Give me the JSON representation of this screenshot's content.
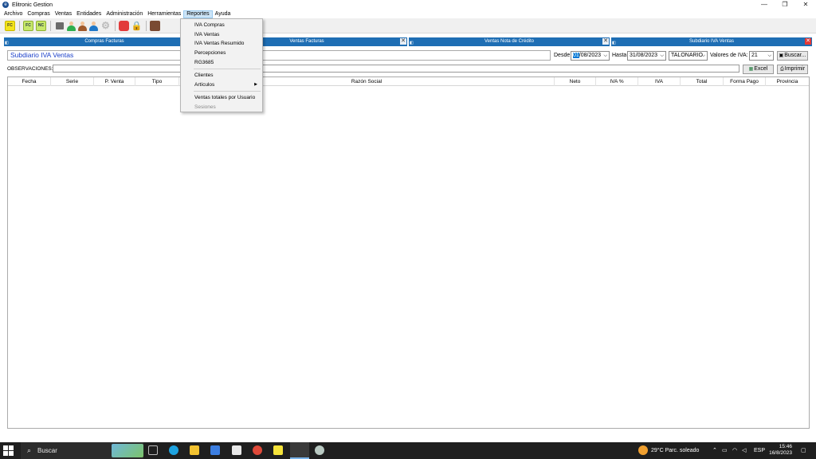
{
  "window": {
    "title": "Elitronic Gestion",
    "minimize": "—",
    "restore": "❐",
    "close": "✕"
  },
  "menu": {
    "items": [
      "Archivo",
      "Compras",
      "Ventas",
      "Entidades",
      "Administración",
      "Herramientas",
      "Reportes",
      "Ayuda"
    ],
    "active": "Reportes"
  },
  "toolbar": {
    "fc": "FC",
    "fc2": "FC",
    "nc": "NC"
  },
  "tabs": [
    {
      "label": "Compras Facturas",
      "closable": false
    },
    {
      "label": "Ventas Facturas",
      "closable": true
    },
    {
      "label": "Ventas Nota de Crédito",
      "closable": true
    },
    {
      "label": "Subdiario IVA Ventas",
      "closable": true
    }
  ],
  "form": {
    "title": "Subdiario IVA Ventas",
    "desde_label": "Desde",
    "desde_day": "01",
    "desde_rest": "/08/2023",
    "hasta_label": "Hasta",
    "hasta_value": "31/08/2023",
    "talonario": "TALONARIO",
    "valores_label": "Valores de IVA:",
    "valores_value": "21",
    "buscar": "Buscar...",
    "observaciones_label": "OBSERVACIONES:",
    "excel": "Excel",
    "imprimir": "Imprimir"
  },
  "grid": {
    "columns": [
      "Fecha",
      "Serie",
      "P. Venta",
      "Tipo",
      "Razón Social",
      "Neto",
      "IVA %",
      "IVA",
      "Total",
      "Forma Pago",
      "Provincia"
    ]
  },
  "dropdown": {
    "items": [
      "IVA Compras",
      "IVA Ventas",
      "IVA Ventas Resumido",
      "Percepciones",
      "RG3685",
      "Clientes",
      "Artículos",
      "Ventas totales por Usuario",
      "Sesiones"
    ],
    "submenu_arrow": "▶"
  },
  "taskbar": {
    "search": "Buscar",
    "weather": "29°C  Parc. soleado",
    "lang": "ESP",
    "time": "15:46",
    "date": "16/8/2023",
    "notifications": "1"
  }
}
